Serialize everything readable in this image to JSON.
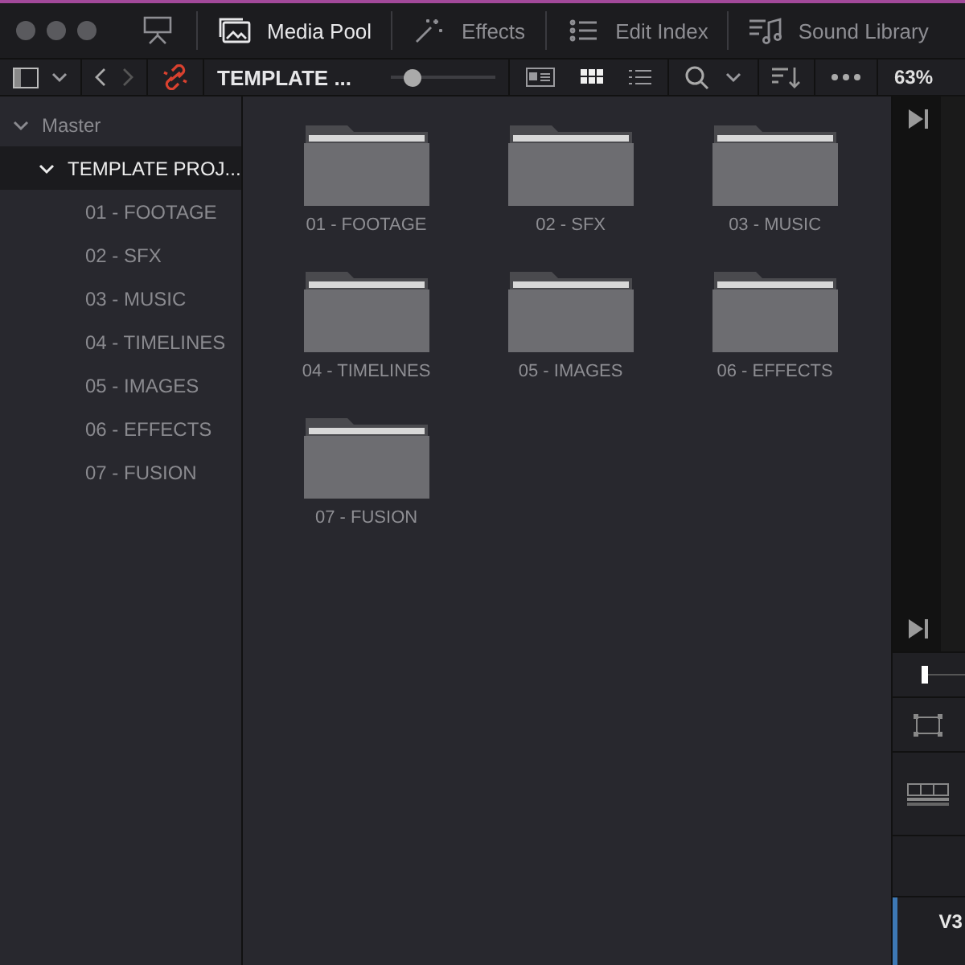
{
  "tabs": [
    {
      "label": "Media Pool",
      "kind": "media",
      "selected": true
    },
    {
      "label": "Effects",
      "kind": "effects",
      "selected": false
    },
    {
      "label": "Edit Index",
      "kind": "index",
      "selected": false
    },
    {
      "label": "Sound Library",
      "kind": "sound",
      "selected": false
    }
  ],
  "toolbar": {
    "bin_name": "TEMPLATE ...",
    "thumb_size": {
      "level": 0.2
    },
    "view_modes": [
      {
        "kind": "metadata",
        "selected": false
      },
      {
        "kind": "thumbnails",
        "selected": true
      },
      {
        "kind": "list",
        "selected": false
      }
    ],
    "zoom": "63%"
  },
  "sidebar": {
    "items": [
      {
        "label": "Master",
        "expanded": true,
        "selected": false,
        "children": [
          {
            "label": "TEMPLATE PROJ...",
            "expanded": true,
            "selected": true,
            "children": [
              {
                "label": "01 - FOOTAGE"
              },
              {
                "label": "02 - SFX"
              },
              {
                "label": "03 - MUSIC"
              },
              {
                "label": "04 - TIMELINES"
              },
              {
                "label": "05 - IMAGES"
              },
              {
                "label": "06 - EFFECTS"
              },
              {
                "label": "07 - FUSION"
              }
            ]
          }
        ]
      }
    ]
  },
  "bins": [
    {
      "label": "01 - FOOTAGE"
    },
    {
      "label": "02 - SFX"
    },
    {
      "label": "03 - MUSIC"
    },
    {
      "label": "04 - TIMELINES"
    },
    {
      "label": "05 - IMAGES"
    },
    {
      "label": "06 - EFFECTS"
    },
    {
      "label": "07 - FUSION"
    }
  ],
  "timeline": {
    "track": "V3"
  }
}
